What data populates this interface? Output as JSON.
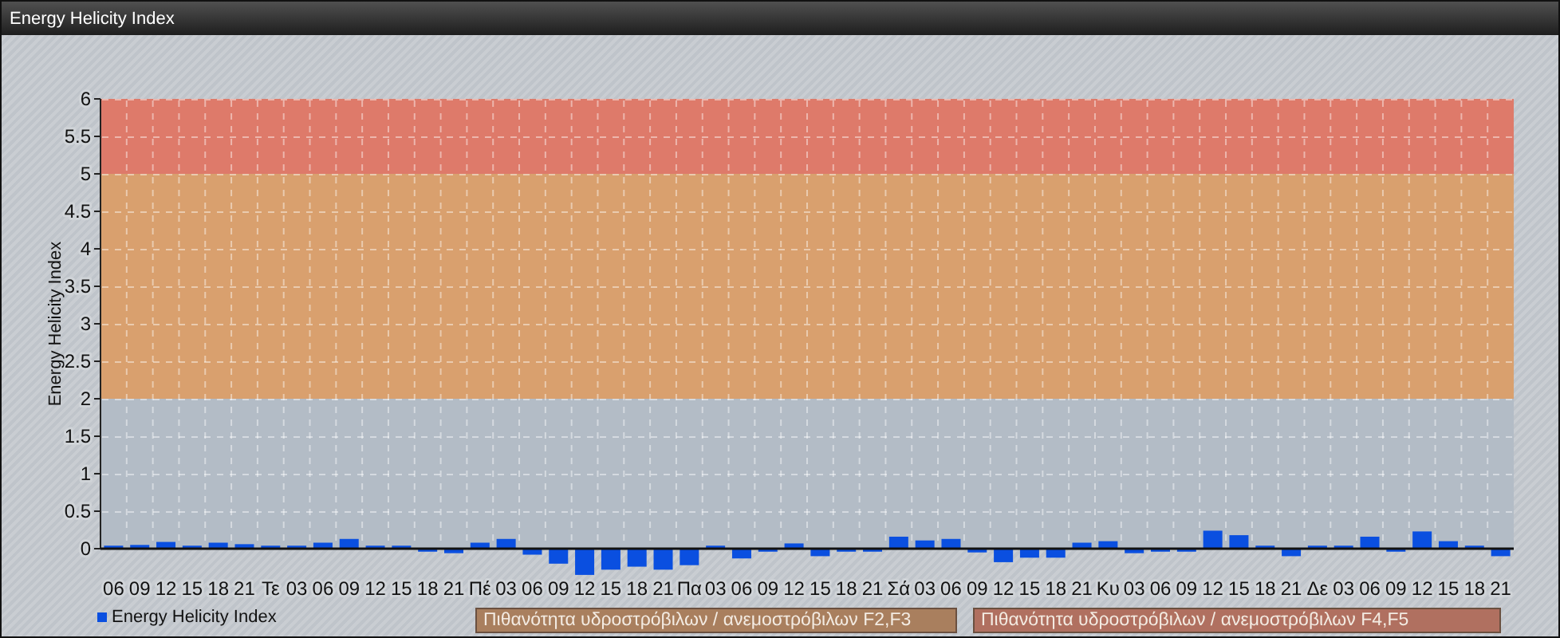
{
  "window": {
    "title": "Energy Helicity Index"
  },
  "chart": {
    "chart_data": {
      "type": "bar",
      "ylabel": "Energy Helicity Index",
      "ylim": [
        -0.4,
        6
      ],
      "grid": true,
      "yticks": [
        0,
        0.5,
        1,
        1.5,
        2,
        2.5,
        3,
        3.5,
        4,
        4.5,
        5,
        5.5,
        6
      ],
      "categories": [
        "06",
        "09",
        "12",
        "15",
        "18",
        "21",
        "Τε",
        "03",
        "06",
        "09",
        "12",
        "15",
        "18",
        "21",
        "Πέ",
        "03",
        "06",
        "09",
        "12",
        "15",
        "18",
        "21",
        "Πα",
        "03",
        "06",
        "09",
        "12",
        "15",
        "18",
        "21",
        "Σά",
        "03",
        "06",
        "09",
        "12",
        "15",
        "18",
        "21",
        "Κυ",
        "03",
        "06",
        "09",
        "12",
        "15",
        "18",
        "21",
        "Δε",
        "03",
        "06",
        "09",
        "12",
        "15",
        "18",
        "21"
      ],
      "series": [
        {
          "name": "Energy Helicity Index",
          "color": "#0a4fe0",
          "values": [
            0.02,
            0.05,
            0.09,
            0.04,
            0.08,
            0.06,
            0.03,
            0.02,
            0.08,
            0.13,
            0.02,
            0.03,
            -0.02,
            -0.06,
            0.08,
            0.13,
            -0.08,
            -0.2,
            -0.35,
            -0.28,
            -0.24,
            -0.28,
            -0.22,
            0.04,
            -0.13,
            -0.04,
            0.07,
            -0.1,
            -0.02,
            -0.02,
            0.16,
            0.11,
            0.13,
            -0.05,
            -0.18,
            -0.12,
            -0.12,
            0.08,
            0.1,
            -0.06,
            -0.03,
            -0.04,
            0.24,
            0.18,
            0.02,
            -0.1,
            0.01,
            0.02,
            0.16,
            -0.03,
            0.23,
            0.1,
            0.03,
            -0.1
          ]
        }
      ],
      "bands": [
        {
          "axis": "y",
          "from": 0,
          "to": 2,
          "color": "#b3bcc6"
        },
        {
          "axis": "y",
          "from": 2,
          "to": 5,
          "color": "#d9a06e"
        },
        {
          "axis": "y",
          "from": 5,
          "to": 6,
          "color": "#de7a6a"
        }
      ]
    },
    "band_legend": [
      {
        "label": "Πιθανότητα υδροστρόβιλων / ανεμοστρόβιλων F2,F3",
        "color": "#a97f5e"
      },
      {
        "label": "Πιθανότητα υδροστρόβιλων / ανεμοστρόβιλων F4,F5",
        "color": "#b07060"
      }
    ]
  }
}
